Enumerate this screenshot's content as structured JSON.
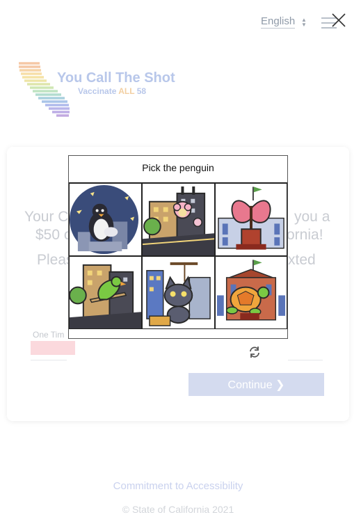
{
  "header": {
    "language": "English",
    "icons": {
      "language_toggle": "up-down-arrows",
      "menu": "hamburger-icon",
      "close": "close-icon"
    }
  },
  "logo": {
    "title": "You Call The Shot",
    "sub_prefix": "Vaccinate ",
    "sub_all": "ALL",
    "sub_suffix": " 58",
    "colors": {
      "text": "#b8c7ea",
      "accent": "#f2cfa2"
    }
  },
  "card": {
    "line1_left": "Your C",
    "line1_right": "you a",
    "line2_left": "$50 c",
    "line2_right": "ornia!",
    "line3_left": "Pleas",
    "line3_right": "xted",
    "otp_label": "One Tim",
    "continue_label": "Continue ❯",
    "refresh_icon": "refresh-icon",
    "colors": {
      "otp_input": "#fbd9dd",
      "continue_bg": "#d4dbef"
    }
  },
  "footer": {
    "accessibility": "Commitment to Accessibility",
    "copyright": "© State of California 2021"
  },
  "captcha": {
    "prompt": "Pick the penguin",
    "tiles": [
      {
        "subject": "penguin"
      },
      {
        "subject": "pink-bear-balloon"
      },
      {
        "subject": "butterfly"
      },
      {
        "subject": "parrot"
      },
      {
        "subject": "cat"
      },
      {
        "subject": "turtle"
      }
    ]
  }
}
